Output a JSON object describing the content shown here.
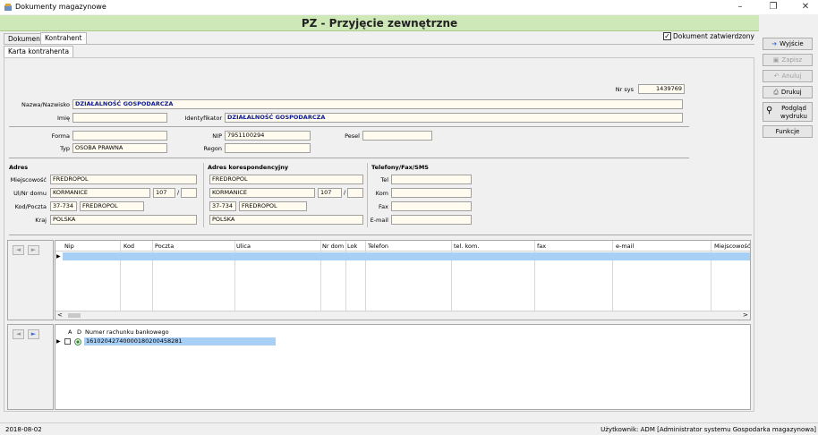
{
  "window": {
    "title": "Dokumenty magazynowe",
    "minimize": "–",
    "maximize": "❐",
    "close": "✕"
  },
  "header": {
    "title": "PZ - Przyjęcie zewnętrzne"
  },
  "tabs": [
    {
      "label": "Dokument"
    },
    {
      "label": "Kontrahent"
    }
  ],
  "subtabs": [
    {
      "label": "Karta kontrahenta"
    }
  ],
  "approved": {
    "label": "Dokument zatwierdzony",
    "checked_mark": "✓"
  },
  "form": {
    "nr_sys_label": "Nr sys",
    "nr_sys": "1439769",
    "nazwa_label": "Nazwa/Nazwisko",
    "nazwa": "DZIAŁALNOŚĆ GOSPODARCZA",
    "imie_label": "Imię",
    "imie": "",
    "identyfikator_label": "Identyfikator",
    "identyfikator": "DZIAŁALNOŚĆ GOSPODARCZA",
    "forma_label": "Forma",
    "forma": "",
    "nip_label": "NIP",
    "nip": "7951100294",
    "pesel_label": "Pesel",
    "pesel": "",
    "typ_label": "Typ",
    "typ": "OSOBA PRAWNA",
    "regon_label": "Regon",
    "regon": ""
  },
  "adres": {
    "title": "Adres",
    "miejscowosc_label": "Miejscowość",
    "miejscowosc": "FREDROPOL",
    "ulica_label": "Ul/Nr domu",
    "ulica": "KORMANICE",
    "nr_domu": "107",
    "slash": "/",
    "nr_lokalu": "",
    "kod_label": "Kod/Poczta",
    "kod": "37-734",
    "poczta": "FREDROPOL",
    "kraj_label": "Kraj",
    "kraj": "POLSKA"
  },
  "adres_koresp": {
    "title": "Adres korespondencyjny",
    "miejscowosc": "FREDROPOL",
    "ulica": "KORMANICE",
    "nr_domu": "107",
    "slash": "/",
    "nr_lokalu": "",
    "kod": "37-734",
    "poczta": "FREDROPOL",
    "kraj": "POLSKA"
  },
  "telefony": {
    "title": "Telefony/Fax/SMS",
    "tel_label": "Tel",
    "tel": "",
    "kom_label": "Kom",
    "kom": "",
    "fax_label": "Fax",
    "fax": "",
    "email_label": "E-mail",
    "email": ""
  },
  "address_grid": {
    "columns": [
      "Nip",
      "Kod",
      "Poczta",
      "Ulica",
      "Nr dom",
      "Lok",
      "Telefon",
      "tel. kom.",
      "fax",
      "e-mail",
      "Miejscowość"
    ],
    "scroll_left": "<",
    "scroll_right": ">",
    "row_pointer": "▶"
  },
  "bank_grid": {
    "col_a": "A",
    "col_d": "D",
    "col_account": "Numer rachunku bankowego",
    "row_pointer": "▶",
    "rows": [
      {
        "account": "16102042740000180200458281"
      }
    ]
  },
  "nav": {
    "prev": "◄",
    "next": "►"
  },
  "toolbar": {
    "exit": "Wyjście",
    "save": "Zapisz",
    "cancel": "Anuluj",
    "print": "Drukuj",
    "preview": "Podgląd wydruku",
    "functions": "Funkcje"
  },
  "status": {
    "date": "2018-08-02",
    "user": "Użytkownik: ADM [Administrator systemu Gospodarka magazynowa]"
  }
}
